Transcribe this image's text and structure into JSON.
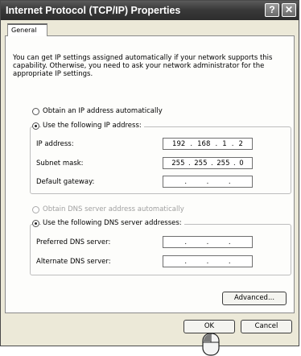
{
  "window": {
    "title": "Internet Protocol (TCP/IP) Properties",
    "help_glyph": "?",
    "close_glyph": "✕"
  },
  "tab": {
    "label": "General"
  },
  "intro": "You can get IP settings assigned automatically if your network supports this capability. Otherwise, you need to ask your network administrator for the appropriate IP settings.",
  "ip_mode": {
    "auto_label": "Obtain an IP address automatically",
    "manual_label": "Use the following IP address:",
    "selected": "manual"
  },
  "ip_fields": {
    "ip_address": {
      "label": "IP address:",
      "octets": [
        "192",
        "168",
        "1",
        "2"
      ]
    },
    "subnet_mask": {
      "label": "Subnet mask:",
      "octets": [
        "255",
        "255",
        "255",
        "0"
      ]
    },
    "default_gateway": {
      "label": "Default gateway:",
      "octets": [
        "",
        "",
        "",
        ""
      ]
    }
  },
  "dns_mode": {
    "auto_label": "Obtain DNS server address automatically",
    "manual_label": "Use the following DNS server addresses:",
    "selected": "manual"
  },
  "dns_fields": {
    "preferred": {
      "label": "Preferred DNS server:",
      "octets": [
        "",
        "",
        "",
        ""
      ]
    },
    "alternate": {
      "label": "Alternate DNS server:",
      "octets": [
        "",
        "",
        "",
        ""
      ]
    }
  },
  "buttons": {
    "advanced": "Advanced...",
    "ok": "OK",
    "cancel": "Cancel"
  },
  "colors": {
    "titlebar": "#3a3a3a",
    "dialog_bg": "#ece9d8",
    "panel_bg": "#fdfdfb"
  }
}
